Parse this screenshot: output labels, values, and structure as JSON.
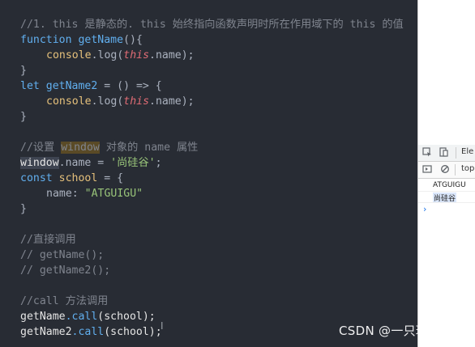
{
  "editor": {
    "lines": {
      "comment1": "//1. this 是静态的. this 始终指向函数声明时所在作用域下的 this 的值",
      "l2_kw": "function",
      "l2_fn": "getName",
      "l2_rest": "(){",
      "l3_console": "console",
      "l3_log": ".log(",
      "l3_this": "this",
      "l3_end": ".name);",
      "l4": "}",
      "l5_kw": "let",
      "l5_fn": "getName2",
      "l5_rest": " = () => {",
      "l6_console": "console",
      "l6_log": ".log(",
      "l6_this": "this",
      "l6_end": ".name);",
      "l7": "}",
      "comment2_a": "//设置 ",
      "comment2_hl": "window",
      "comment2_b": " 对象的 name 属性",
      "l9_window": "window",
      "l9_rest": ".name = ",
      "l9_str": "'尚硅谷'",
      "l9_end": ";",
      "l10_kw": "const",
      "l10_var": "school",
      "l10_rest": " = {",
      "l11_key": "name",
      "l11_colon": ": ",
      "l11_str": "\"ATGUIGU\"",
      "l12": "}",
      "comment3": "//直接调用",
      "comment4": "// getName();",
      "comment5": "// getName2();",
      "comment6": "//call 方法调用",
      "l17_fn": "getName",
      "l17_call": ".call",
      "l17_rest": "(school);",
      "l18_fn": "getName2",
      "l18_call": ".call",
      "l18_rest": "(school);"
    }
  },
  "devtools": {
    "tab_elements": "Ele",
    "context": "top",
    "console_output": [
      "ATGUIGU",
      "尚硅谷"
    ],
    "prompt": "›"
  },
  "watermark": "CSDN @一只琳娜",
  "colors": {
    "editor_bg": "#282c34",
    "comment": "#7f848e",
    "keyword": "#61afef",
    "string": "#98c379",
    "this": "#e06c75",
    "identifier": "#e5c07b"
  }
}
